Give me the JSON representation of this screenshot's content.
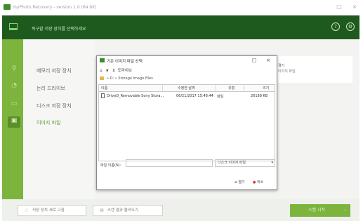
{
  "window": {
    "title": "myPhoto Recovery - version 1.0 (64 bit)",
    "minimize_glyph": "□",
    "close_glyph": "×"
  },
  "header": {
    "title": "복구할 저장 장치를 선택하세요",
    "help_glyph": "?",
    "settings_glyph": "⚙"
  },
  "sidebar": {
    "icons": [
      "usb-icon",
      "disk-icon",
      "drive-icon",
      "image-file-icon"
    ],
    "items": [
      {
        "label": "메모리 저장 장치"
      },
      {
        "label": "논리 드라이브"
      },
      {
        "label": "디스크 저장 장치"
      },
      {
        "label": "이미지 파일"
      }
    ],
    "active_index": 3
  },
  "info_card": {
    "line1": "경기",
    "line2": "이미지 파일"
  },
  "dialog": {
    "title": "기존 이미지 파일 선택",
    "max_glyph": "□",
    "close_glyph": "×",
    "toolbar_label": "도라이브",
    "breadcrumb": "» D: » Storage Image Files",
    "columns": [
      "이름",
      "수정한 날짜",
      "유형",
      "크기"
    ],
    "rows": [
      {
        "name": "DriveD_Removable Sony Stora...",
        "date": "06/21/2017 15:48:44",
        "type": "파일",
        "size": "26188 KB"
      }
    ],
    "filename_label": "파일 이름(N):",
    "filename_value": "",
    "filetype_value": "디스크 이미지 파일",
    "open_label": "열기",
    "cancel_label": "취소"
  },
  "footer": {
    "new_scan_label": "저장 장치 새로 고침",
    "load_results_label": "스캔 결과 불러오기",
    "start_label": "스캔 시작"
  },
  "colors": {
    "header_bg": "#1e5a1e",
    "sidebar_bg": "#7db43d",
    "accent": "#7db43d"
  }
}
